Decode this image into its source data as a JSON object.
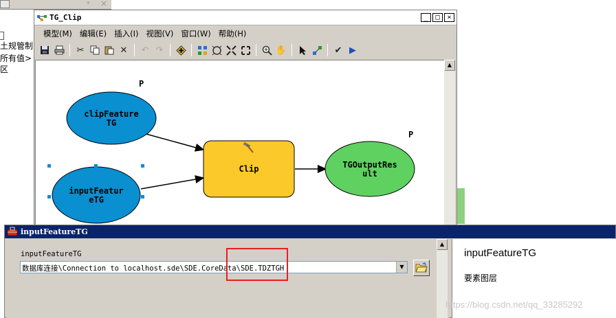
{
  "background": {
    "tree_lines": [
      "土规管制",
      "所有值>",
      "区"
    ]
  },
  "window": {
    "title": "TG_Clip",
    "controls": [
      "_",
      "□",
      "×"
    ],
    "menu": [
      "模型(M)",
      "编辑(E)",
      "插入(I)",
      "视图(V)",
      "窗口(W)",
      "帮助(H)"
    ]
  },
  "model": {
    "nodes": {
      "clip_feature": [
        "clipFeature",
        "TG"
      ],
      "input_feature": [
        "inputFeatur",
        "eTG"
      ],
      "tool": "Clip",
      "output": [
        "TGOutputRes",
        "ult"
      ]
    },
    "param_markers": [
      "P",
      "P"
    ],
    "colors": {
      "data_fill": "#0a8fd0",
      "tool_fill": "#fcc92a",
      "output_fill": "#5fd160",
      "selection_handles": "#0a8fd0"
    }
  },
  "dialog": {
    "title": "inputFeatureTG",
    "param_label": "inputFeatureTG",
    "param_value": "数据库连接\\Connection to localhost.sde\\SDE.CoreData\\SDE.TDZTGH",
    "help_title": "inputFeatureTG",
    "help_desc": "要素图层",
    "watermark": "https://blog.csdn.net/qq_33285292",
    "highlight_color": "#e52020"
  }
}
